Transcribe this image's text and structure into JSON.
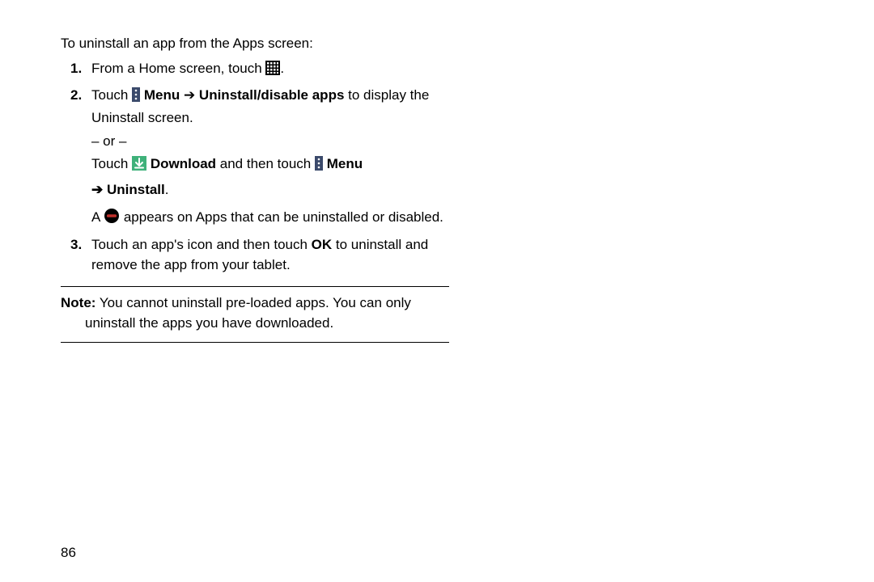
{
  "intro": "To uninstall an app from the Apps screen:",
  "steps": [
    {
      "num": "1.",
      "line1_a": "From a Home screen, touch ",
      "line1_b": "."
    },
    {
      "num": "2.",
      "l1_a": "Touch ",
      "l1_menu": "Menu",
      "l1_arrow": " ➔ ",
      "l1_uninstall": "Uninstall/disable apps",
      "l1_b": " to display the Uninstall screen.",
      "or": "– or –",
      "l2_a": "Touch ",
      "l2_dl": "Download",
      "l2_b": " and then touch ",
      "l2_menu": "Menu",
      "l3_arrow": "➔ ",
      "l3_uninstall": "Uninstall",
      "l3_b": ".",
      "l4_a": "A ",
      "l4_b": " appears on Apps that can be uninstalled or disabled."
    },
    {
      "num": "3.",
      "l1_a": "Touch an app's icon and then touch ",
      "l1_ok": "OK",
      "l1_b": " to uninstall and remove the app from your tablet."
    }
  ],
  "note": {
    "label": "Note:",
    "line1": " You cannot uninstall pre-loaded apps. You can only",
    "line2": "uninstall the apps you have downloaded."
  },
  "page_number": "86"
}
